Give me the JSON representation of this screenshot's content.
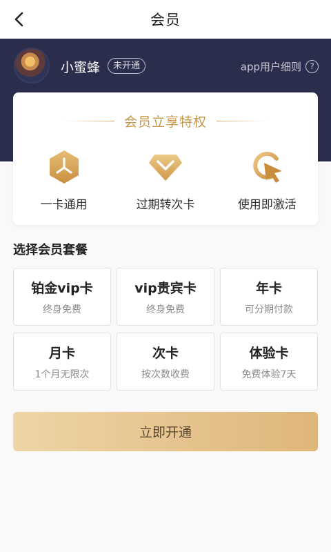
{
  "colors": {
    "hero_bg": "#2b2d4d",
    "gold_accent": "#d4a869",
    "button_gradient_start": "#eed4a6",
    "button_gradient_end": "#dfb67a"
  },
  "navbar": {
    "back_icon": "chevron-left-icon",
    "title": "会员"
  },
  "user": {
    "name": "小蜜蜂",
    "status": "未开通",
    "rules_link": "app用户细则",
    "help_icon": "question-circle-icon"
  },
  "privileges": {
    "title": "会员立享特权",
    "items": [
      {
        "icon": "hexagon-split-icon",
        "label": "一卡通用"
      },
      {
        "icon": "diamond-chevron-icon",
        "label": "过期转次卡"
      },
      {
        "icon": "cursor-click-icon",
        "label": "使用即激活"
      }
    ]
  },
  "plans": {
    "section_title": "选择会员套餐",
    "items": [
      {
        "name": "铂金vip卡",
        "desc": "终身免费"
      },
      {
        "name": "vip贵宾卡",
        "desc": "终身免费"
      },
      {
        "name": "年卡",
        "desc": "可分期付款"
      },
      {
        "name": "月卡",
        "desc": "1个月无限次"
      },
      {
        "name": "次卡",
        "desc": "按次数收费"
      },
      {
        "name": "体验卡",
        "desc": "免费体验7天"
      }
    ]
  },
  "action": {
    "open_button": "立即开通"
  }
}
